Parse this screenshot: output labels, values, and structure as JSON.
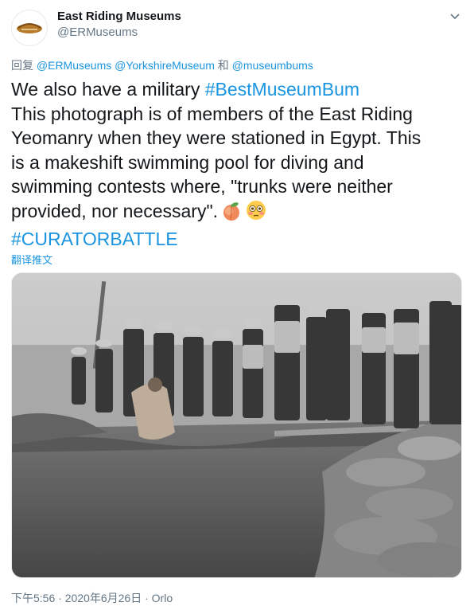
{
  "account": {
    "display_name": "East Riding Museums",
    "handle": "@ERMuseums"
  },
  "reply": {
    "prefix": "回复",
    "mention_1": "@ERMuseums",
    "mention_2": "@YorkshireMuseum",
    "conjunction": "和",
    "mention_3": "@museumbums"
  },
  "tweet": {
    "line1_text": "We also have a military ",
    "line1_hashtag": "#BestMuseumBum",
    "line2": "This photograph is of members of the East Riding",
    "line3": "Yeomanry when they were stationed in Egypt. This",
    "line4": "is a makeshift swimming pool for diving and",
    "line5": "swimming contests where, \"trunks were neither",
    "line6": "provided, nor necessary\".",
    "hashtag_curator": "#CURATORBATTLE"
  },
  "translate_label": "翻译推文",
  "footer": {
    "time": "下午5:56",
    "date": "2020年6月26日",
    "separator": "·",
    "source": "Orlo"
  },
  "colors": {
    "link": "#1b95e0",
    "secondary_text": "#657786",
    "primary_text": "#14171a"
  },
  "icons": {
    "caret": "chevron-down-icon",
    "emoji_1": "peach-emoji",
    "emoji_2": "flushed-face-emoji"
  }
}
